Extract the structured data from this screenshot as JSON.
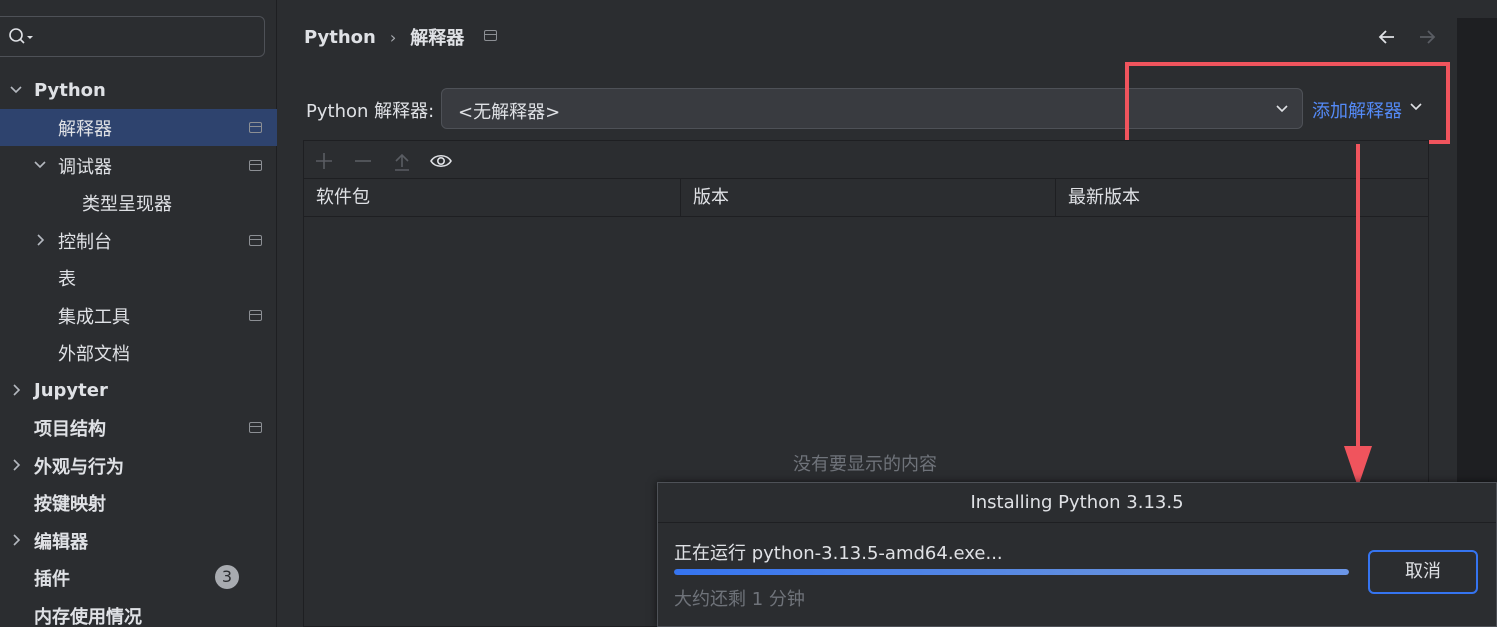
{
  "sidebar": {
    "search": {
      "value": ""
    },
    "items": [
      {
        "label": "Python",
        "bold": true,
        "expanded": true
      },
      {
        "label": "解释器",
        "selected": true
      },
      {
        "label": "调试器",
        "expanded": true
      },
      {
        "label": "类型呈现器"
      },
      {
        "label": "控制台"
      },
      {
        "label": "表"
      },
      {
        "label": "集成工具"
      },
      {
        "label": "外部文档"
      },
      {
        "label": "Jupyter",
        "bold": true
      },
      {
        "label": "项目结构",
        "bold": true
      },
      {
        "label": "外观与行为",
        "bold": true
      },
      {
        "label": "按键映射",
        "bold": true
      },
      {
        "label": "编辑器",
        "bold": true
      },
      {
        "label": "插件",
        "bold": true,
        "badge": "3"
      },
      {
        "label": "内存使用情况",
        "bold": true
      }
    ]
  },
  "breadcrumb": {
    "root": "Python",
    "current": "解释器"
  },
  "interpreter": {
    "label": "Python 解释器:",
    "value": "<无解释器>",
    "add_link": "添加解释器"
  },
  "packages": {
    "toolbar": [
      "plus-icon",
      "minus-icon",
      "upgrade-icon",
      "eye-icon"
    ],
    "columns": [
      "软件包",
      "版本",
      "最新版本"
    ],
    "empty_text": "没有要显示的内容"
  },
  "dialog": {
    "title": "Installing Python 3.13.5",
    "status": "正在运行 python-3.13.5-amd64.exe...",
    "progress": 1.0,
    "remaining": "大约还剩 1 分钟",
    "cancel_label": "取消"
  },
  "colors": {
    "accent": "#3574f0",
    "link": "#548af7",
    "highlight": "#f0545d",
    "selection": "#2e436e"
  }
}
